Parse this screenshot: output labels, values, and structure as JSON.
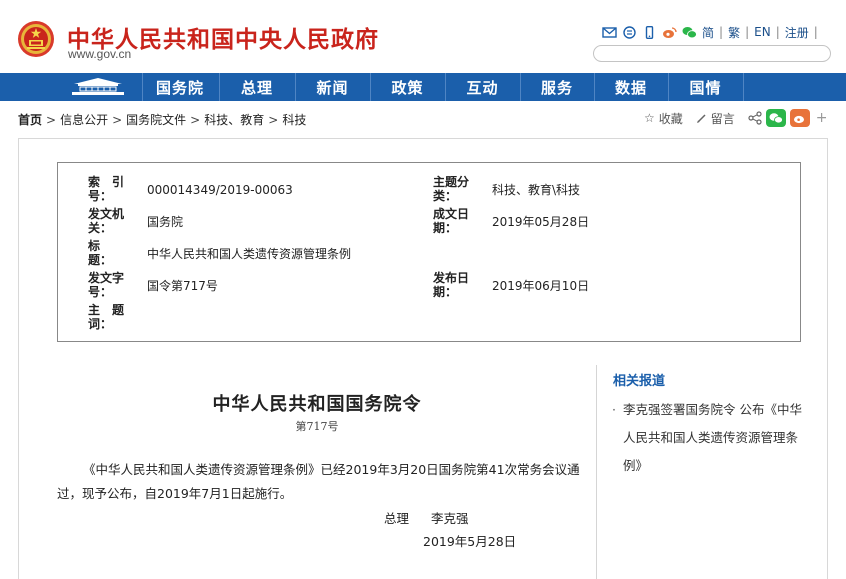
{
  "header": {
    "site_title": "中华人民共和国中央人民政府",
    "domain": "www.gov.cn",
    "links": {
      "simplified": "简",
      "traditional": "繁",
      "english": "EN",
      "register": "注册"
    },
    "separator": "|"
  },
  "nav": {
    "items": [
      "国务院",
      "总理",
      "新闻",
      "政策",
      "互动",
      "服务",
      "数据",
      "国情"
    ]
  },
  "breadcrumb": {
    "items": [
      "首页",
      "信息公开",
      "国务院文件",
      "科技、教育",
      "科技"
    ],
    "separator": ">"
  },
  "tools": {
    "favorite": "收藏",
    "comment": "留言"
  },
  "info": {
    "index_label": [
      "索　引",
      "号："
    ],
    "index_value": "000014349/2019-00063",
    "category_label": [
      "主题分",
      "类："
    ],
    "category_value": "科技、教育\\科技",
    "issuer_label": [
      "发文机",
      "关："
    ],
    "issuer_value": "国务院",
    "created_label": [
      "成文日",
      "期："
    ],
    "created_value": "2019年05月28日",
    "title_label": [
      "标　　",
      "题："
    ],
    "title_value": "中华人民共和国人类遗传资源管理条例",
    "docno_label": [
      "发文字",
      "号："
    ],
    "docno_value": "国令第717号",
    "published_label": [
      "发布日",
      "期："
    ],
    "published_value": "2019年06月10日",
    "subject_label": [
      "主　题",
      "词："
    ]
  },
  "article": {
    "title": "中华人民共和国国务院令",
    "order_no": "第717号",
    "paragraph": "《中华人民共和国人类遗传资源管理条例》已经2019年3月20日国务院第41次常务会议通过，现予公布，自2019年7月1日起施行。",
    "sign_title": "总理",
    "sign_name": "李克强",
    "date": "2019年5月28日"
  },
  "related": {
    "title": "相关报道",
    "items": [
      "李克强签署国务院令  公布《中华人民共和国人类遗传资源管理条例》"
    ]
  },
  "colors": {
    "brand_red": "#c9241c",
    "nav_blue": "#1b5fab",
    "wechat_green": "#2bb64a",
    "weibo_orange": "#e8733a"
  }
}
